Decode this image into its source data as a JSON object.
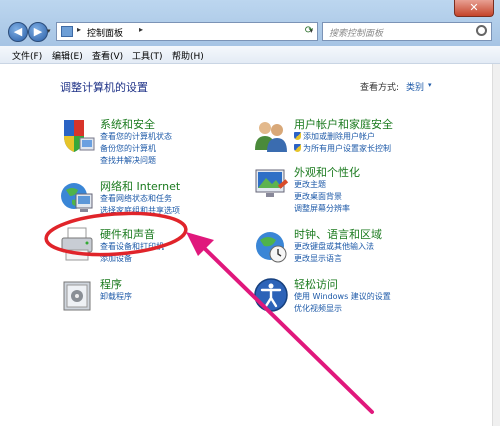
{
  "window": {
    "close_label": "✕"
  },
  "address": {
    "location": "控制面板",
    "sep": "▸",
    "dropdown": "▾"
  },
  "search": {
    "placeholder": "搜索控制面板"
  },
  "menu": [
    {
      "label": "文件(F)"
    },
    {
      "label": "编辑(E)"
    },
    {
      "label": "查看(V)"
    },
    {
      "label": "工具(T)"
    },
    {
      "label": "帮助(H)"
    }
  ],
  "page": {
    "title": "调整计算机的设置",
    "view_label": "查看方式:",
    "view_value": "类别",
    "view_dd": "▾"
  },
  "categories": {
    "system": {
      "title": "系统和安全",
      "links": [
        "查看您的计算机状态",
        "备份您的计算机",
        "查找并解决问题"
      ]
    },
    "network": {
      "title": "网络和 Internet",
      "links": [
        "查看网络状态和任务",
        "选择家庭组和共享选项"
      ]
    },
    "hardware": {
      "title": "硬件和声音",
      "links": [
        "查看设备和打印机",
        "添加设备"
      ]
    },
    "programs": {
      "title": "程序",
      "links": [
        "卸载程序"
      ]
    },
    "user": {
      "title": "用户帐户和家庭安全",
      "links": [
        "添加或删除用户帐户",
        "为所有用户设置家长控制"
      ]
    },
    "appearance": {
      "title": "外观和个性化",
      "links": [
        "更改主题",
        "更改桌面背景",
        "调整屏幕分辨率"
      ]
    },
    "clock": {
      "title": "时钟、语言和区域",
      "links": [
        "更改键盘或其他输入法",
        "更改显示语言"
      ]
    },
    "access": {
      "title": "轻松访问",
      "links": [
        "使用 Windows 建议的设置",
        "优化视频显示"
      ]
    }
  },
  "colors": {
    "annotation": "#e0187c",
    "title_green": "#1a7a1e",
    "link_blue": "#1e5aa8"
  }
}
